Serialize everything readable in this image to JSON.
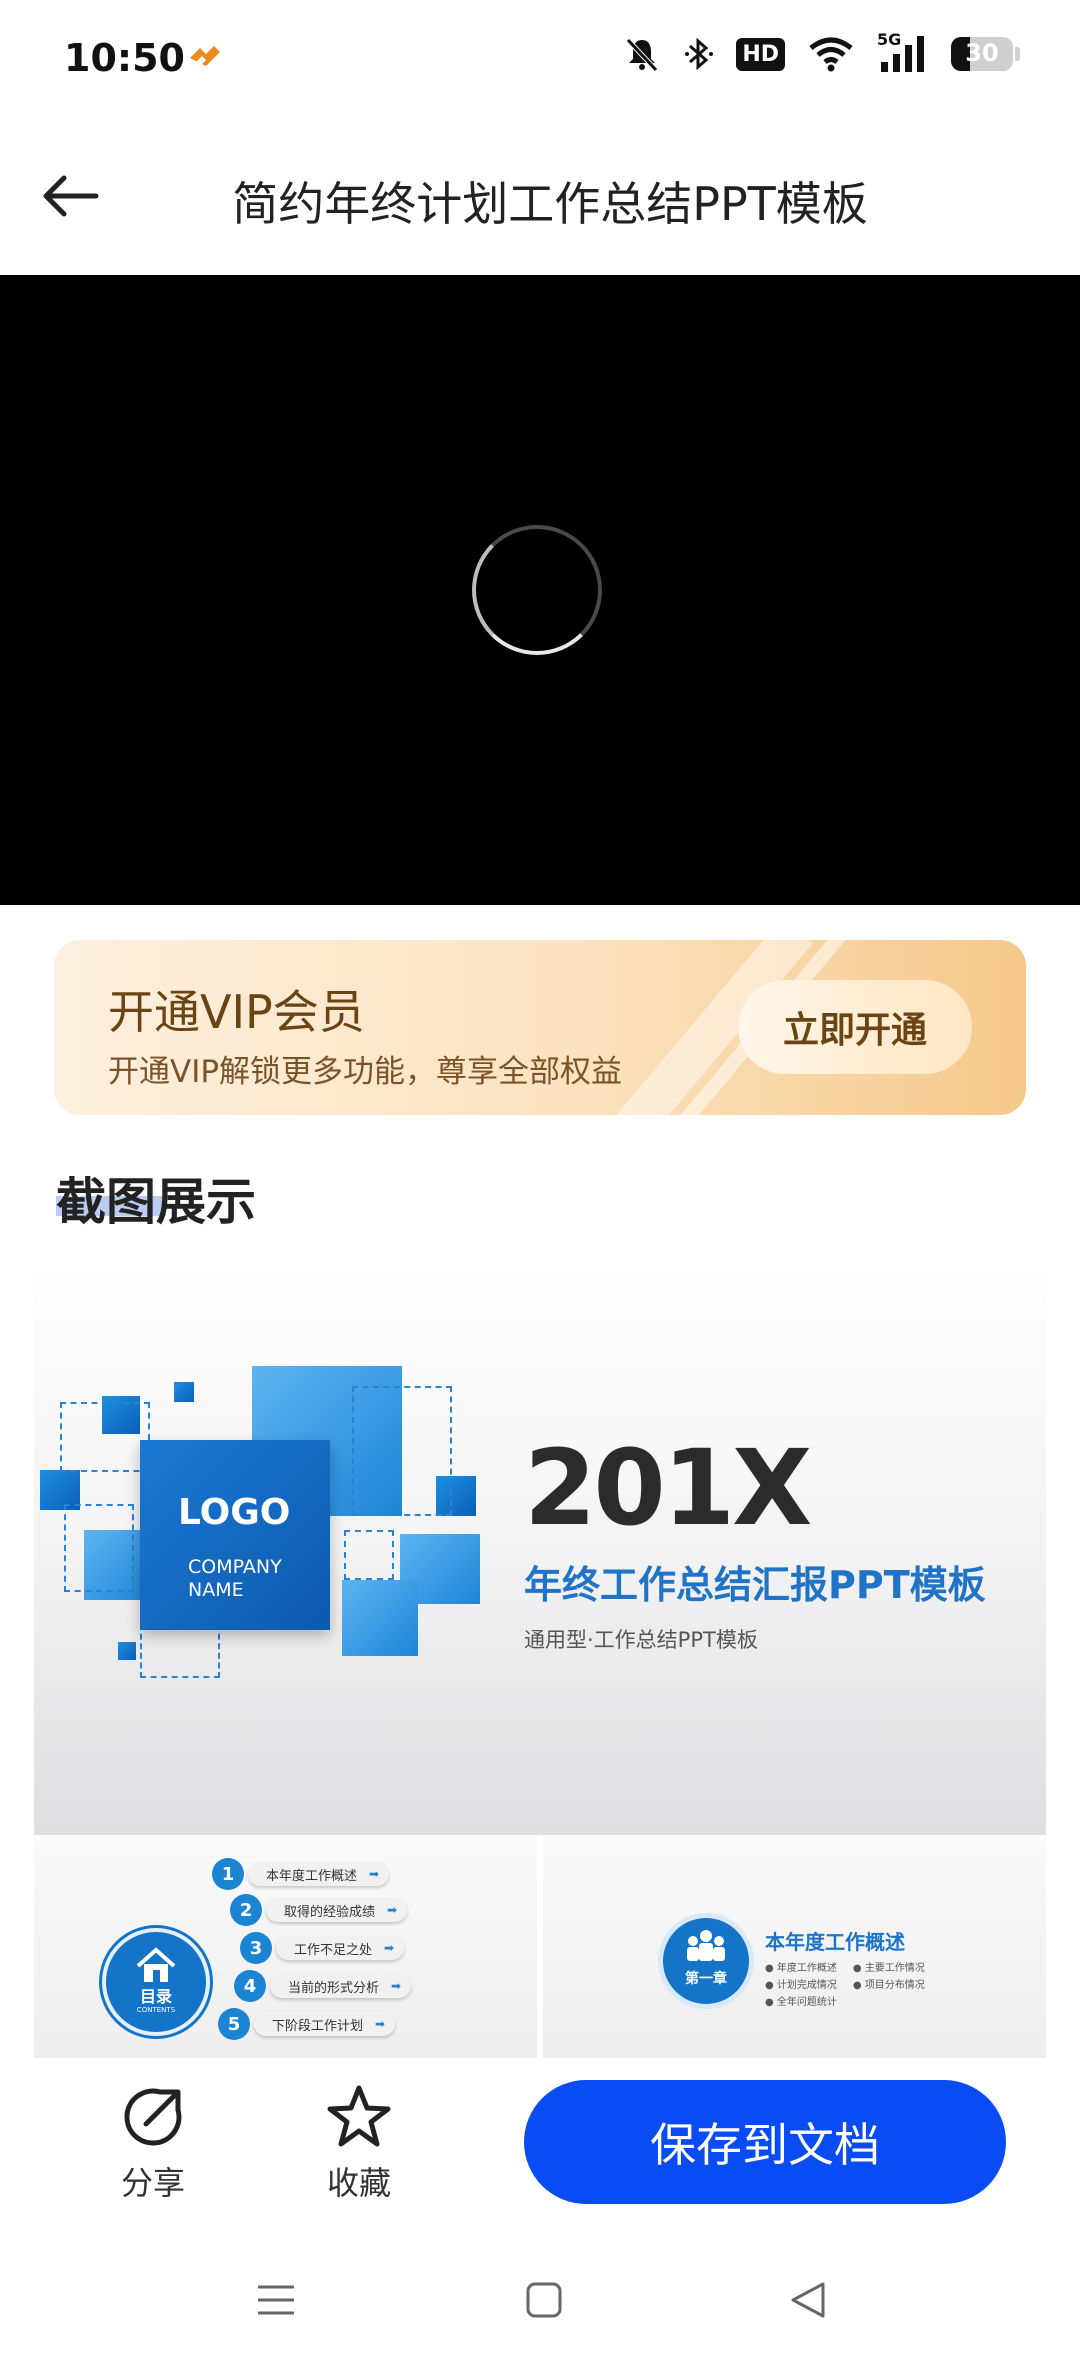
{
  "status_bar": {
    "time": "10:50",
    "hd_label": "HD",
    "network_label": "5G",
    "battery_level": "30",
    "battery_percent": 30
  },
  "header": {
    "back_icon": "arrow-left-icon",
    "title": "简约年终计划工作总结PPT模板"
  },
  "video": {
    "state": "loading",
    "spinner_icon": "loading-spinner-icon"
  },
  "vip_banner": {
    "title": "开通VIP会员",
    "subtitle": "开通VIP解锁更多功能，尊享全部权益",
    "button_label": "立即开通"
  },
  "screenshots": {
    "section_title": "截图展示",
    "cover": {
      "logo": "LOGO",
      "company_line1": "COMPANY",
      "company_line2": "NAME",
      "year": "201X",
      "heading": "年终工作总结汇报PPT模板",
      "caption": "通用型·工作总结PPT模板"
    },
    "toc": {
      "badge_label": "目录",
      "badge_sub": "CONTENTS",
      "items": [
        {
          "num": "1",
          "label": "本年度工作概述"
        },
        {
          "num": "2",
          "label": "取得的经验成绩"
        },
        {
          "num": "3",
          "label": "工作不足之处"
        },
        {
          "num": "4",
          "label": "当前的形式分析"
        },
        {
          "num": "5",
          "label": "下阶段工作计划"
        }
      ]
    },
    "chapter": {
      "badge_label": "第一章",
      "title": "本年度工作概述",
      "bullets": [
        "年度工作概述",
        "主要工作情况",
        "计划完成情况",
        "项目分布情况",
        "全年问题统计"
      ]
    }
  },
  "actions": {
    "share_label": "分享",
    "share_icon": "share-icon",
    "favorite_label": "收藏",
    "favorite_icon": "star-icon",
    "save_label": "保存到文档"
  },
  "nav_bar": {
    "menu_icon": "menu-icon",
    "home_icon": "home-square-icon",
    "back_icon": "back-triangle-icon"
  },
  "colors": {
    "primary": "#0a4cf4",
    "vip_text": "#6b4414",
    "slide_blue": "#1474c8"
  }
}
